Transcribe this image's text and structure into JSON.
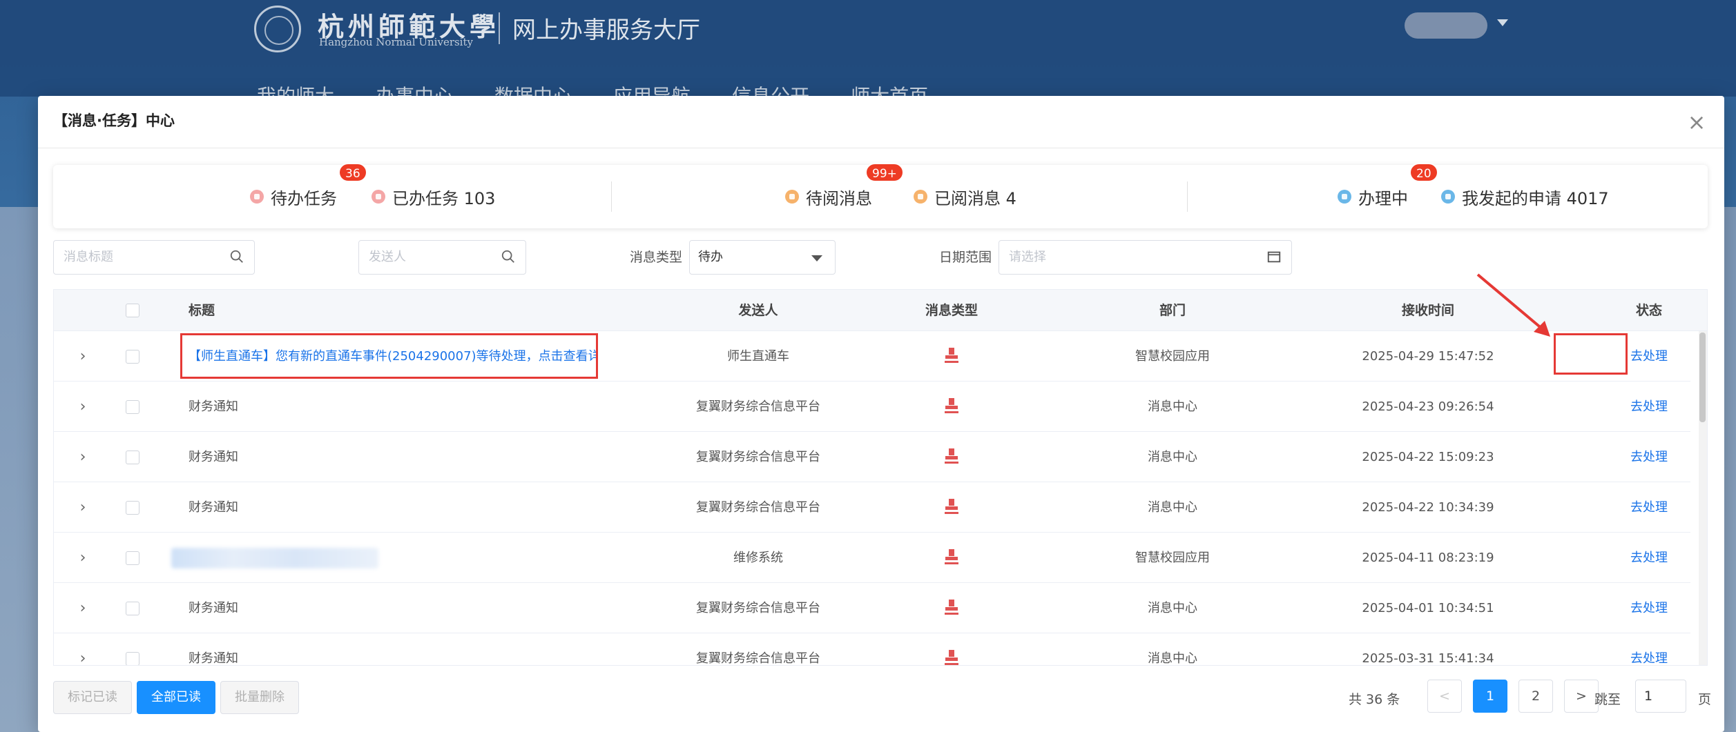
{
  "background": {
    "university_cn": "杭州師範大學",
    "university_en": "Hangzhou Normal University",
    "portal_title": "网上办事服务大厅",
    "nav": [
      "我的师大",
      "办事中心",
      "数据中心",
      "应用导航",
      "信息公开",
      "师大首页"
    ]
  },
  "modal": {
    "title": "【消息·任务】中心",
    "close_icon": "close-icon"
  },
  "summary": {
    "pending_tasks": {
      "label": "待办任务",
      "badge": "36"
    },
    "done_tasks": {
      "label": "已办任务 103"
    },
    "unread_messages": {
      "label": "待阅消息",
      "badge": "99+"
    },
    "read_messages": {
      "label": "已阅消息 4"
    },
    "in_progress": {
      "label": "办理中",
      "badge": "20"
    },
    "my_applications": {
      "label": "我发起的申请 4017"
    },
    "badge_color": "#ee3b24"
  },
  "filters": {
    "title_placeholder": "消息标题",
    "sender_placeholder": "发送人",
    "type_label": "消息类型",
    "type_value": "待办",
    "date_label": "日期范围",
    "date_placeholder": "请选择"
  },
  "table": {
    "headers": {
      "title": "标题",
      "sender": "发送人",
      "type": "消息类型",
      "dept": "部门",
      "time": "接收时间",
      "status": "状态"
    },
    "rows": [
      {
        "title": "【师生直通车】您有新的直通车事件(2504290007)等待处理，点击查看详",
        "sender": "师生直通车",
        "dept": "智慧校园应用",
        "time": "2025-04-29 15:47:52",
        "status": "去处理"
      },
      {
        "title": "财务通知",
        "sender": "复翼财务综合信息平台",
        "dept": "消息中心",
        "time": "2025-04-23 09:26:54",
        "status": "去处理"
      },
      {
        "title": "财务通知",
        "sender": "复翼财务综合信息平台",
        "dept": "消息中心",
        "time": "2025-04-22 15:09:23",
        "status": "去处理"
      },
      {
        "title": "财务通知",
        "sender": "复翼财务综合信息平台",
        "dept": "消息中心",
        "time": "2025-04-22 10:34:39",
        "status": "去处理"
      },
      {
        "title": "",
        "sender": "维修系统",
        "dept": "智慧校园应用",
        "time": "2025-04-11 08:23:19",
        "status": "去处理"
      },
      {
        "title": "财务通知",
        "sender": "复翼财务综合信息平台",
        "dept": "消息中心",
        "time": "2025-04-01 10:34:51",
        "status": "去处理"
      },
      {
        "title": "财务通知",
        "sender": "复翼财务综合信息平台",
        "dept": "消息中心",
        "time": "2025-03-31 15:41:34",
        "status": "去处理"
      }
    ]
  },
  "footer": {
    "mark_read": "标记已读",
    "mark_all_read": "全部已读",
    "batch_delete": "批量删除",
    "total": "共 36 条",
    "prev": "<",
    "pages": [
      "1",
      "2"
    ],
    "next": ">",
    "jump_label": "跳至",
    "jump_value": "1",
    "page_unit": "页"
  },
  "colors": {
    "primary": "#1890ff",
    "link": "#1a73e8",
    "highlight_box": "#e53935",
    "doc_icon": "#e05252"
  }
}
